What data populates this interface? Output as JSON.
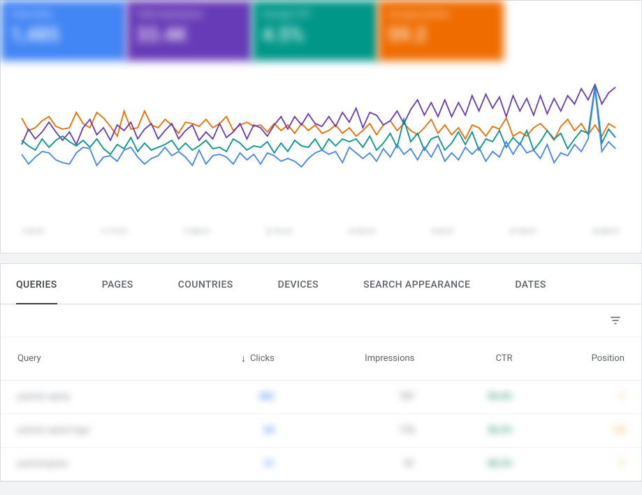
{
  "tiles": [
    {
      "label": "Total clicks",
      "value": "1,485",
      "color": "#4285f4"
    },
    {
      "label": "Total impressions",
      "value": "33.4K",
      "color": "#673ab7"
    },
    {
      "label": "Average CTR",
      "value": "4.5%",
      "color": "#009688"
    },
    {
      "label": "Average position",
      "value": "59.2",
      "color": "#ef6c00"
    }
  ],
  "chart_data": {
    "type": "line",
    "title": "",
    "xlabel": "",
    "ylabel": "",
    "x_ticks": [
      "1/6/21",
      "1/17/21",
      "1/28/21",
      "2/10/21",
      "2/23/21",
      "3/4/21",
      "3/18/21",
      "3/28/21"
    ],
    "series": [
      {
        "name": "Clicks",
        "color": "#4285f4",
        "values": [
          86,
          72,
          82,
          90,
          88,
          78,
          74,
          72,
          88,
          96,
          94,
          70,
          82,
          84,
          76,
          92,
          96,
          82,
          72,
          80,
          84,
          96,
          84,
          90,
          82,
          70,
          92,
          72,
          84,
          86,
          82,
          72,
          88,
          78,
          86,
          72,
          88,
          84,
          76,
          80,
          76,
          68,
          80,
          88,
          92,
          86,
          90,
          74,
          96,
          88,
          80,
          88,
          76,
          94,
          82,
          100,
          86,
          94,
          78,
          96,
          82,
          100,
          76,
          88,
          78,
          96,
          86,
          96,
          76,
          90,
          82,
          104,
          86,
          102,
          88,
          92,
          80,
          100,
          74,
          88,
          84,
          100,
          90,
          108,
          180,
          90,
          104,
          94
        ]
      },
      {
        "name": "Impressions",
        "color": "#673ab7",
        "values": [
          100,
          122,
          108,
          118,
          132,
          118,
          106,
          118,
          100,
          124,
          136,
          114,
          124,
          106,
          128,
          120,
          132,
          108,
          122,
          130,
          108,
          120,
          130,
          108,
          120,
          128,
          106,
          118,
          108,
          130,
          110,
          118,
          130,
          108,
          128,
          124,
          112,
          128,
          140,
          122,
          140,
          128,
          144,
          130,
          126,
          140,
          126,
          146,
          132,
          152,
          124,
          146,
          142,
          128,
          134,
          148,
          130,
          150,
          164,
          142,
          160,
          140,
          164,
          140,
          160,
          142,
          170,
          148,
          172,
          152,
          168,
          140,
          170,
          148,
          166,
          142,
          170,
          144,
          166,
          148,
          170,
          158,
          180,
          164,
          186,
          158,
          174,
          182
        ]
      },
      {
        "name": "CTR",
        "color": "#009688",
        "values": [
          106,
          98,
          92,
          108,
          96,
          106,
          112,
          104,
          98,
          106,
          96,
          108,
          94,
          86,
          100,
          94,
          110,
          90,
          102,
          92,
          96,
          100,
          106,
          92,
          102,
          92,
          98,
          106,
          94,
          96,
          90,
          108,
          102,
          92,
          98,
          96,
          104,
          88,
          102,
          90,
          106,
          98,
          96,
          108,
          92,
          108,
          98,
          108,
          104,
          108,
          96,
          112,
          92,
          102,
          116,
          96,
          136,
          104,
          116,
          92,
          108,
          112,
          92,
          102,
          118,
          100,
          118,
          92,
          108,
          104,
          120,
          96,
          110,
          100,
          120,
          92,
          104,
          120,
          108,
          116,
          94,
          108,
          120,
          116,
          184,
          102,
          122,
          110
        ]
      },
      {
        "name": "Position",
        "color": "#ef6c00",
        "values": [
          138,
          120,
          124,
          134,
          140,
          126,
          122,
          124,
          146,
          130,
          124,
          146,
          138,
          126,
          112,
          148,
          122,
          124,
          148,
          128,
          124,
          136,
          128,
          116,
          132,
          130,
          126,
          136,
          124,
          130,
          140,
          120,
          128,
          132,
          126,
          128,
          118,
          130,
          120,
          128,
          116,
          130,
          120,
          128,
          116,
          120,
          128,
          116,
          124,
          112,
          120,
          130,
          114,
          128,
          134,
          120,
          130,
          120,
          114,
          124,
          136,
          116,
          128,
          114,
          124,
          108,
          128,
          124,
          112,
          126,
          122,
          138,
          112,
          118,
          112,
          124,
          130,
          120,
          106,
          126,
          136,
          120,
          130,
          114,
          128,
          112,
          130,
          124
        ]
      }
    ]
  },
  "tabs": [
    "QUERIES",
    "PAGES",
    "COUNTRIES",
    "DEVICES",
    "SEARCH APPEARANCE",
    "DATES"
  ],
  "active_tab": 0,
  "table": {
    "columns": {
      "query": "Query",
      "clicks": "Clicks",
      "impressions": "Impressions",
      "ctr": "CTR",
      "position": "Position"
    },
    "sort_column": "clicks",
    "rows": [
      {
        "query": "premio spine",
        "clicks": "482",
        "impressions": "757",
        "ctr": "59.4%",
        "position": "1"
      },
      {
        "query": "premio spine logo",
        "clicks": "60",
        "impressions": "176",
        "ctr": "36.2%",
        "position": "1.8"
      },
      {
        "query": "premiospine",
        "clicks": "31",
        "impressions": "51",
        "ctr": "60.2%",
        "position": "1"
      }
    ]
  }
}
